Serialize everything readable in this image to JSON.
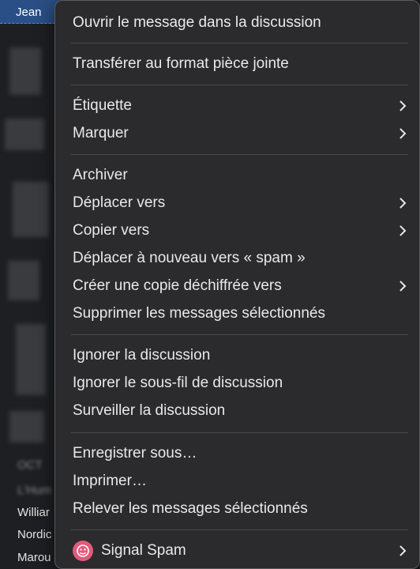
{
  "background": {
    "header_name": "Jean",
    "senders": [
      "Williar",
      "Nordic",
      "Marou"
    ],
    "blurred_rows": [
      "OCT",
      "L'Hum"
    ]
  },
  "menu": {
    "items": [
      {
        "label": "Ouvrir le message dans la discussion"
      },
      {
        "label": "Transférer au format pièce jointe"
      },
      {
        "label": "Étiquette",
        "submenu": true
      },
      {
        "label": "Marquer",
        "submenu": true
      },
      {
        "label": "Archiver"
      },
      {
        "label": "Déplacer vers",
        "submenu": true
      },
      {
        "label": "Copier vers",
        "submenu": true
      },
      {
        "label": "Déplacer à nouveau vers « spam »"
      },
      {
        "label": "Créer une copie déchiffrée vers",
        "submenu": true
      },
      {
        "label": "Supprimer les messages sélectionnés"
      },
      {
        "label": "Ignorer la discussion"
      },
      {
        "label": "Ignorer le sous-fil de discussion"
      },
      {
        "label": "Surveiller la discussion"
      },
      {
        "label": "Enregistrer sous…"
      },
      {
        "label": "Imprimer…"
      },
      {
        "label": "Relever les messages sélectionnés"
      },
      {
        "label": "Signal Spam",
        "submenu": true,
        "icon": "signal-spam-icon"
      }
    ]
  },
  "colors": {
    "menu_bg": "#2b2b2d",
    "text": "#e9e9eb",
    "separator": "#4a4a4c",
    "accent": "#2a4f86",
    "spam_icon": "#e25a7a"
  }
}
